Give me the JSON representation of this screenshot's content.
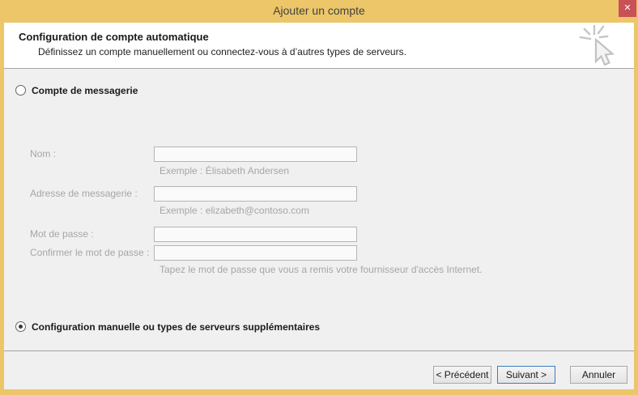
{
  "window": {
    "title": "Ajouter un compte",
    "close_glyph": "✕",
    "colors": {
      "titlebar_gold": "#ecc669",
      "close_red": "#c85156",
      "panel_gray": "#f0f0f0",
      "header_white": "#ffffff",
      "next_button_border_blue": "#3d7ebd",
      "disabled_text_gray": "#a6a6a6"
    }
  },
  "header": {
    "title": "Configuration de compte automatique",
    "subtitle": "Définissez un compte manuellement ou connectez-vous à d’autres types de serveurs.",
    "icon": "cursor-click-icon"
  },
  "form": {
    "radio_email": {
      "label": "Compte de messagerie",
      "selected": false
    },
    "fields": [
      {
        "label": "Nom :",
        "value": "",
        "example": "Exemple : Élisabeth Andersen"
      },
      {
        "label": "Adresse de messagerie :",
        "value": "",
        "example": "Exemple : elizabeth@contoso.com"
      },
      {
        "label": "Mot de passe :",
        "value": ""
      },
      {
        "label": "Confirmer le mot de passe :",
        "value": "",
        "note": "Tapez le mot de passe que vous a remis votre fournisseur d'accès Internet."
      }
    ],
    "radio_manual": {
      "label": "Configuration manuelle ou types de serveurs supplémentaires",
      "selected": true
    }
  },
  "footer": {
    "back_label": "< Précédent",
    "next_label": "Suivant >",
    "cancel_label": "Annuler"
  }
}
